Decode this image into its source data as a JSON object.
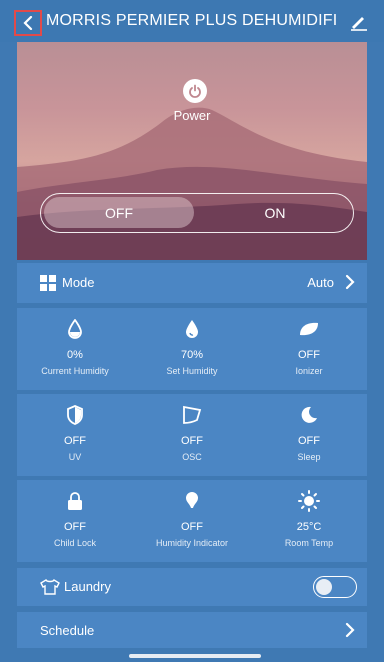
{
  "header": {
    "title": "MORRIS PERMIER PLUS DEHUMIDIFIE...",
    "back_icon": "chevron-left-icon",
    "edit_icon": "pencil-icon"
  },
  "hero": {
    "power_label": "Power",
    "power_icon": "power-icon",
    "toggle": {
      "off_label": "OFF",
      "on_label": "ON",
      "selected": "OFF"
    }
  },
  "mode": {
    "label": "Mode",
    "value": "Auto",
    "icon": "grid-icon"
  },
  "tiles": [
    [
      {
        "value": "0%",
        "label": "Current Humidity",
        "icon": "droplet-outline-icon"
      },
      {
        "value": "70%",
        "label": "Set Humidity",
        "icon": "droplet-filled-icon"
      },
      {
        "value": "OFF",
        "label": "Ionizer",
        "icon": "leaf-icon"
      }
    ],
    [
      {
        "value": "OFF",
        "label": "UV",
        "icon": "shield-icon"
      },
      {
        "value": "OFF",
        "label": "OSC",
        "icon": "oscillation-icon"
      },
      {
        "value": "OFF",
        "label": "Sleep",
        "icon": "moon-icon"
      }
    ],
    [
      {
        "value": "OFF",
        "label": "Child Lock",
        "icon": "lock-icon"
      },
      {
        "value": "OFF",
        "label": "Humidity Indicator",
        "icon": "bulb-icon"
      },
      {
        "value": "25°C",
        "label": "Room Temp",
        "icon": "sun-icon"
      }
    ]
  ],
  "laundry": {
    "label": "Laundry",
    "icon": "shirt-icon",
    "enabled": false
  },
  "schedule": {
    "label": "Schedule"
  },
  "colors": {
    "background": "#3f79b3",
    "panel": "#4b86c4",
    "highlight_border": "#e24a4a"
  }
}
